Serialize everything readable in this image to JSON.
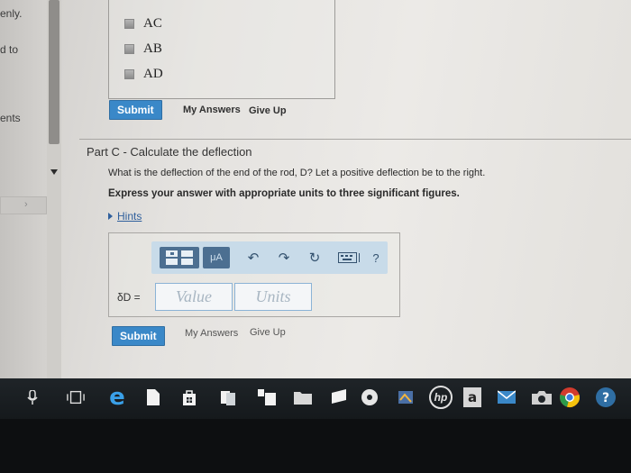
{
  "side": {
    "fragments": [
      "enly.",
      "d to",
      "ents"
    ]
  },
  "part_b": {
    "options": [
      "AC",
      "AB",
      "AD"
    ],
    "submit_label": "Submit",
    "my_answers_label": "My Answers",
    "give_up_label": "Give Up"
  },
  "part_c": {
    "title": "Part C - Calculate the deflection",
    "question": "What is the deflection of the end of the rod, D? Let a positive deflection be to the right.",
    "instruction": "Express your answer with appropriate units to three significant figures.",
    "hints_label": "Hints",
    "toolbar": {
      "units_label": "μA",
      "help_label": "?"
    },
    "variable_label": "δD =",
    "value_placeholder": "Value",
    "units_placeholder": "Units",
    "submit_label": "Submit",
    "my_answers_label": "My Answers",
    "give_up_label": "Give Up"
  },
  "taskbar": {
    "icons": [
      "microphone-icon",
      "task-view-icon",
      "edge-icon",
      "file-icon",
      "store-icon",
      "documents-icon",
      "photos-icon",
      "folder-icon",
      "media-icon",
      "disc-icon",
      "app-icon",
      "hp-icon",
      "amazon-icon",
      "mail-icon",
      "camera-icon",
      "chrome-icon",
      "help-icon"
    ],
    "amazon_label": "a",
    "hp_label": "hp"
  },
  "colors": {
    "accent": "#3a88c8",
    "link": "#2f5f9c",
    "taskbar": "#1a1e22"
  }
}
